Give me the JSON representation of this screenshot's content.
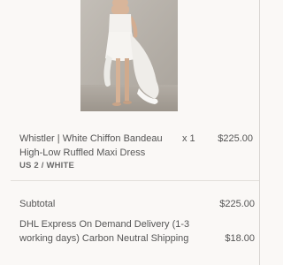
{
  "cart": {
    "item": {
      "title": "Whistler | White Chiffon Bandeau High-Low Ruffled Maxi Dress",
      "variant": "US 2 / WHITE",
      "quantity": "x 1",
      "price": "$225.00"
    },
    "summary": {
      "subtotal_label": "Subtotal",
      "subtotal_value": "$225.00",
      "shipping_label": "DHL Express On Demand Delivery (1-3 working days) Carbon Neutral Shipping",
      "shipping_value": "$18.00"
    }
  },
  "colors": {
    "background": "#faf8f6",
    "text": "#555555",
    "divider": "#e2dfdb"
  }
}
